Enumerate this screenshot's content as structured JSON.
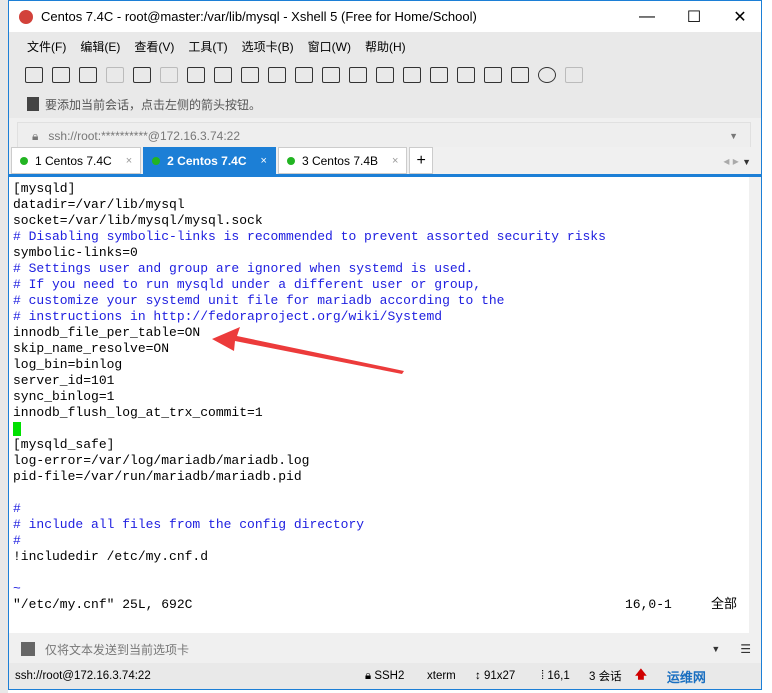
{
  "window": {
    "title": "Centos 7.4C - root@master:/var/lib/mysql - Xshell 5 (Free for Home/School)",
    "minimize": "—",
    "maximize": "☐",
    "close": "✕"
  },
  "menu": [
    "文件(F)",
    "编辑(E)",
    "查看(V)",
    "工具(T)",
    "选项卡(B)",
    "窗口(W)",
    "帮助(H)"
  ],
  "hint": "要添加当前会话，点击左侧的箭头按钮。",
  "address": "ssh://root:**********@172.16.3.74:22",
  "tabs": [
    {
      "label": "1 Centos 7.4C",
      "close": "×"
    },
    {
      "label": "2 Centos 7.4C",
      "close": "×",
      "active": true
    },
    {
      "label": "3 Centos 7.4B",
      "close": "×"
    }
  ],
  "add_tab": "+",
  "terminal": {
    "lines": [
      "[mysqld]",
      "datadir=/var/lib/mysql",
      "socket=/var/lib/mysql/mysql.sock",
      "# Disabling symbolic-links is recommended to prevent assorted security risks",
      "symbolic-links=0",
      "# Settings user and group are ignored when systemd is used.",
      "# If you need to run mysqld under a different user or group,",
      "# customize your systemd unit file for mariadb according to the",
      "# instructions in http://fedoraproject.org/wiki/Systemd",
      "innodb_file_per_table=ON",
      "skip_name_resolve=ON",
      "log_bin=binlog",
      "server_id=101",
      "sync_binlog=1",
      "innodb_flush_log_at_trx_commit=1",
      "",
      "[mysqld_safe]",
      "log-error=/var/log/mariadb/mariadb.log",
      "pid-file=/var/run/mariadb/mariadb.pid",
      "",
      "#",
      "# include all files from the config directory",
      "#",
      "!includedir /etc/my.cnf.d",
      "",
      "~"
    ],
    "status_file": "\"/etc/my.cnf\" 25L, 692C",
    "status_pos": "16,0-1",
    "status_all": "全部"
  },
  "compose_placeholder": "仅将文本发送到当前选项卡",
  "statusbar": {
    "address": "ssh://root@172.16.3.74:22",
    "protocol": "SSH2",
    "term": "xterm",
    "size": "91x27",
    "cursor": "16,1",
    "sessions": "3 会话"
  },
  "watermark": "运维网"
}
